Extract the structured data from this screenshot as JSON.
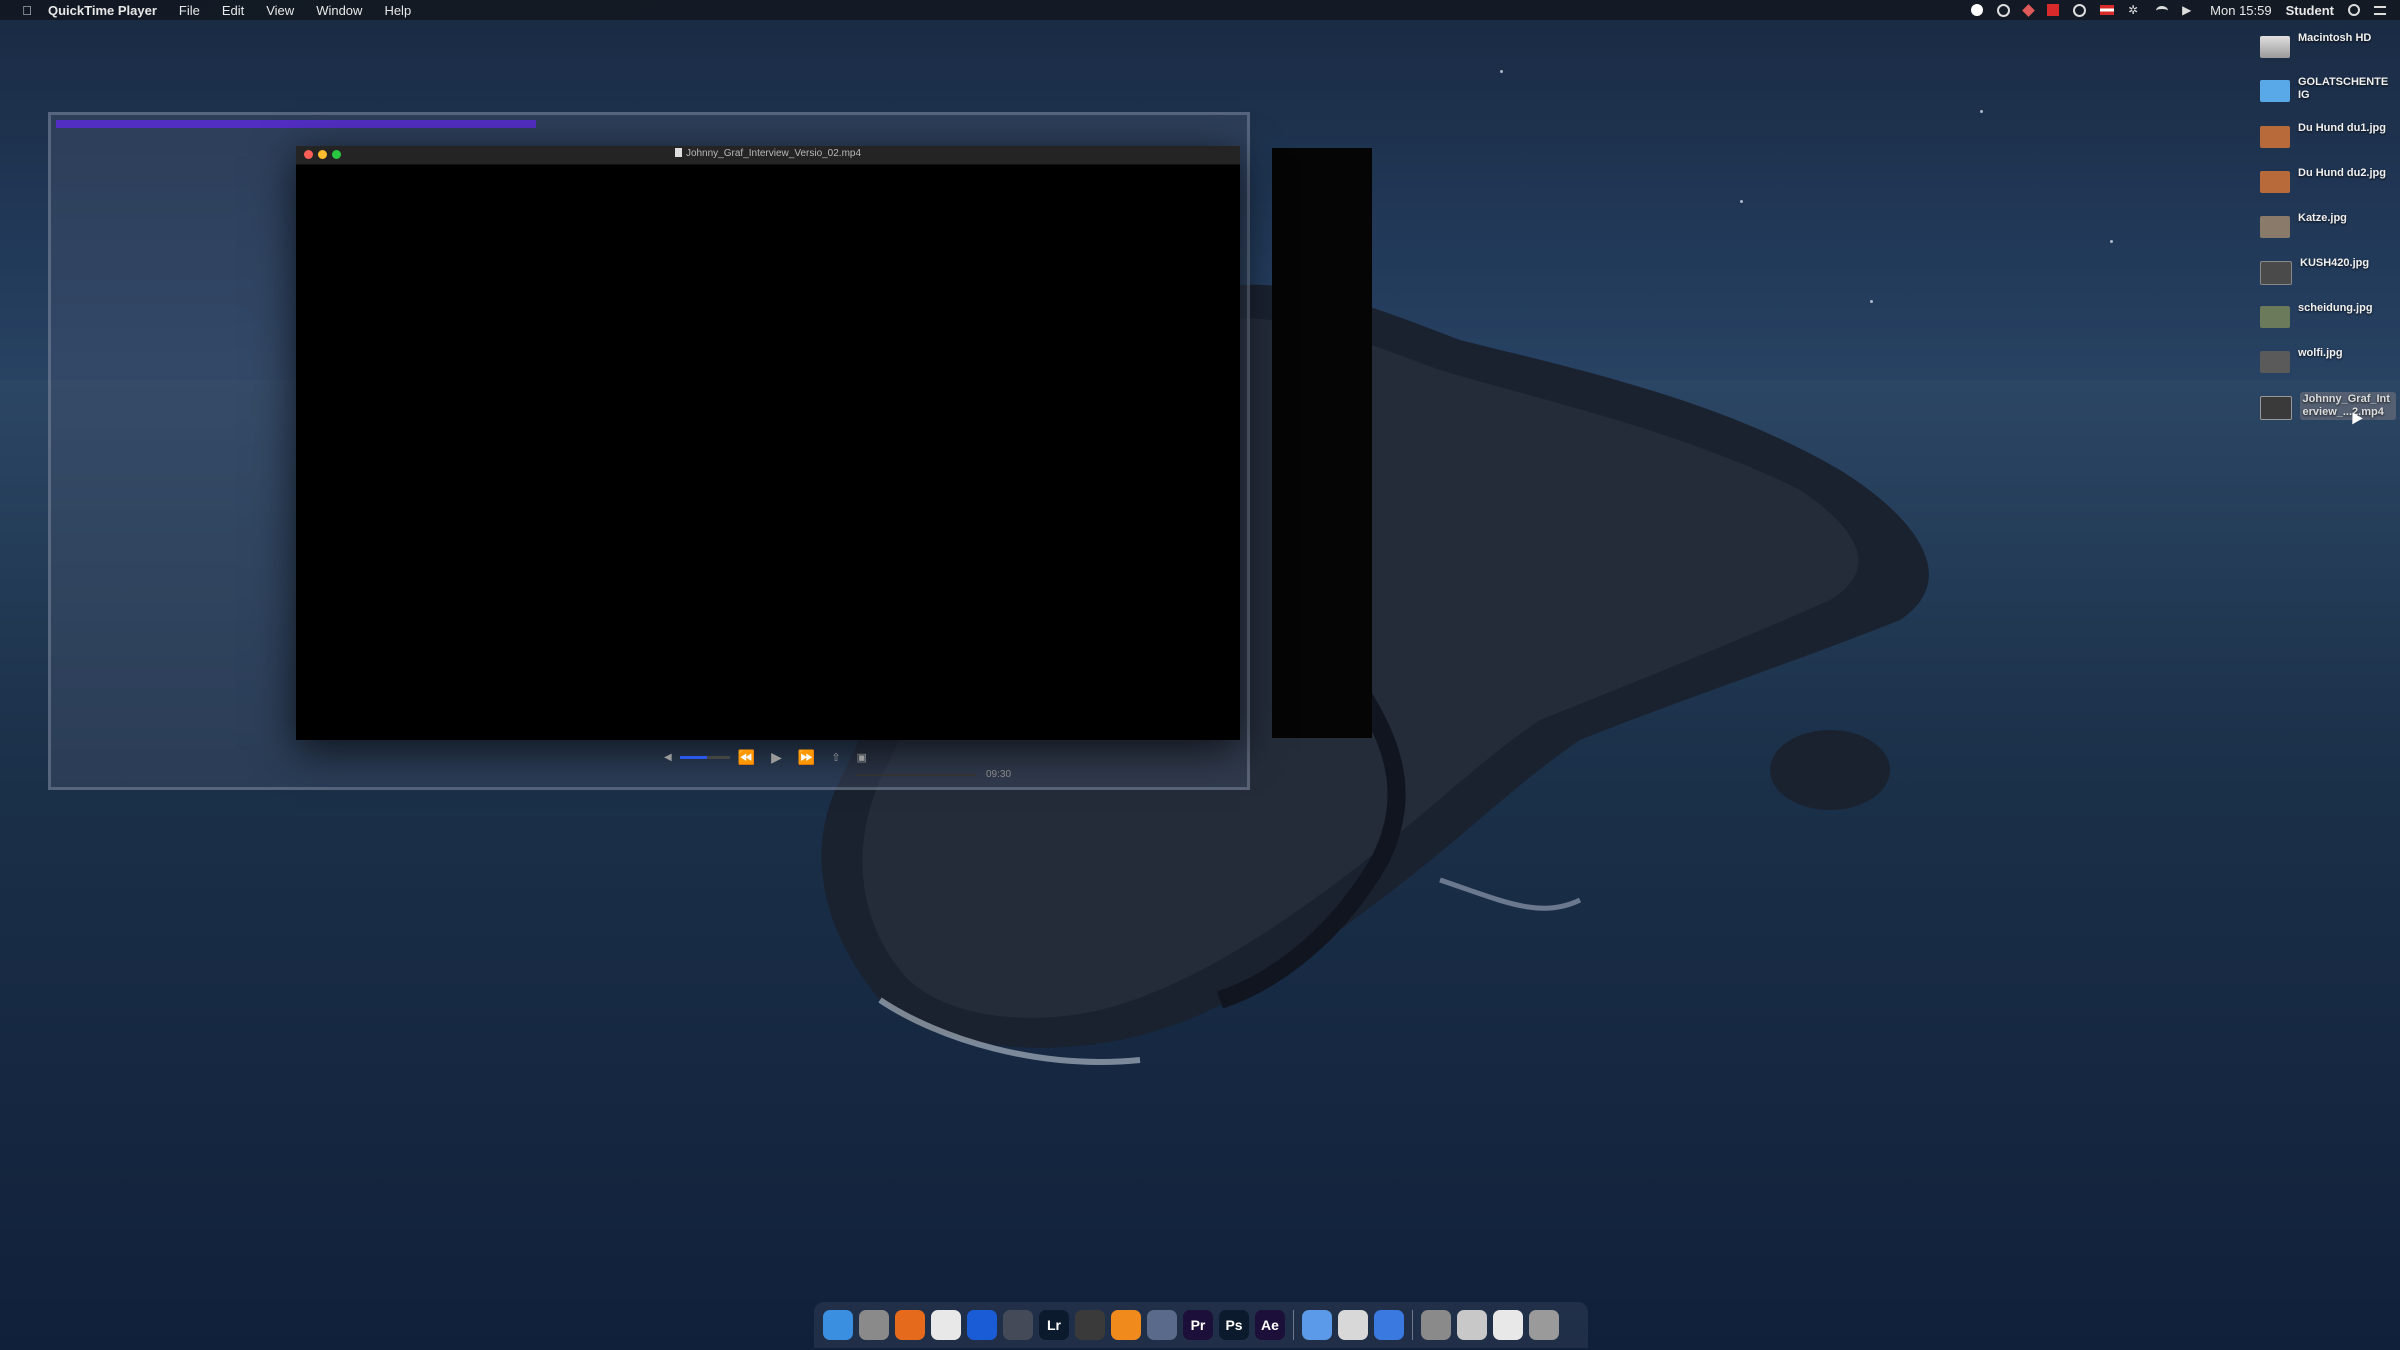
{
  "menubar": {
    "app_name": "QuickTime Player",
    "menus": [
      "File",
      "Edit",
      "View",
      "Window",
      "Help"
    ],
    "clock": "Mon 15:59",
    "user": "Student"
  },
  "desktop": {
    "icons": [
      {
        "label": "Macintosh HD",
        "color": "#c8c8c8"
      },
      {
        "label": "GOLATSCHENTEIG",
        "color": "#59a8e8"
      },
      {
        "label": "Du Hund du1.jpg",
        "color": "#b86a3a"
      },
      {
        "label": "Du Hund du2.jpg",
        "color": "#b86a3a"
      },
      {
        "label": "Katze.jpg",
        "color": "#8a7a6a"
      },
      {
        "label": "KUSH420.jpg",
        "color": "#4a4a4a"
      },
      {
        "label": "scheidung.jpg",
        "color": "#6a7a5a"
      },
      {
        "label": "wolfi.jpg",
        "color": "#5a5a5a"
      },
      {
        "label": "Johnny_Graf_Interview_...2.mp4",
        "color": "#3a3a3a",
        "selected": true
      }
    ]
  },
  "player": {
    "title": "Johnny_Graf_Interview_Versio_02.mp4",
    "time_remaining": "09:30",
    "volume_level": 0.55
  },
  "dock": {
    "apps": [
      {
        "icon": "finder-icon",
        "text": "",
        "color": "#3b8fe0"
      },
      {
        "icon": "system-preferences-icon",
        "text": "",
        "color": "#8a8a8a"
      },
      {
        "icon": "firefox-icon",
        "text": "",
        "color": "#e56a1c"
      },
      {
        "icon": "chrome-icon",
        "text": "",
        "color": "#e8e8e8"
      },
      {
        "icon": "1password-icon",
        "text": "",
        "color": "#1a5bd6"
      },
      {
        "icon": "davinci-resolve-icon",
        "text": "",
        "color": "#444a58"
      },
      {
        "icon": "lightroom-icon",
        "text": "Lr",
        "color": "#0b1a2c"
      },
      {
        "icon": "final-cut-pro-icon",
        "text": "",
        "color": "#3a3a3a"
      },
      {
        "icon": "blender-icon",
        "text": "",
        "color": "#f08a1c"
      },
      {
        "icon": "quicktime-icon",
        "text": "",
        "color": "#5a6a8a"
      },
      {
        "icon": "premiere-pro-icon",
        "text": "Pr",
        "color": "#1c0f3a"
      },
      {
        "icon": "photoshop-icon",
        "text": "Ps",
        "color": "#0b1a2c"
      },
      {
        "icon": "after-effects-icon",
        "text": "Ae",
        "color": "#1c0f3a"
      },
      {
        "icon": "info-icon",
        "text": "",
        "color": "#5a9ae8"
      },
      {
        "icon": "preview-icon",
        "text": "",
        "color": "#d8d8d8"
      },
      {
        "icon": "safari-icon",
        "text": "",
        "color": "#3a7ae0"
      },
      {
        "icon": "archive-utility-icon",
        "text": "",
        "color": "#8a8a8a"
      },
      {
        "icon": "script-editor-icon",
        "text": "",
        "color": "#c8c8c8"
      },
      {
        "icon": "desktop-folder-icon",
        "text": "",
        "color": "#e8e8e8"
      },
      {
        "icon": "trash-icon",
        "text": "",
        "color": "#9a9a9a"
      }
    ]
  }
}
